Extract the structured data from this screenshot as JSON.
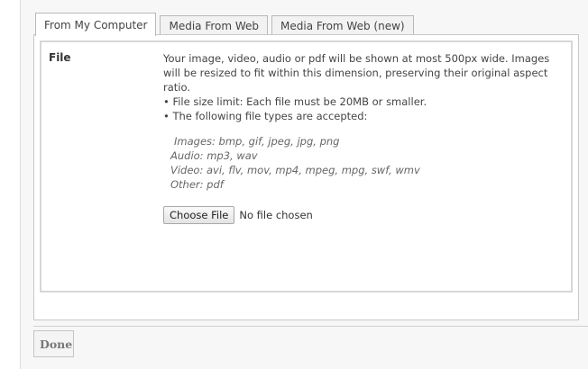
{
  "tabs": [
    {
      "label": "From My Computer"
    },
    {
      "label": "Media From Web"
    },
    {
      "label": "Media From Web (new)"
    }
  ],
  "file_field": {
    "label": "File",
    "description": "Your image, video, audio or pdf will be shown at most 500px wide. Images will be resized to fit within this dimension, preserving their original aspect ratio.",
    "bullets": [
      "• File size limit: Each file must be 20MB or smaller.",
      "• The following file types are accepted:"
    ],
    "accepted_types": [
      "Images: bmp, gif, jpeg, jpg, png",
      "Audio: mp3, wav",
      "Video: avi, flv, mov, mp4, mpeg, mpg, swf, wmv",
      "Other: pdf"
    ],
    "choose_button": "Choose File",
    "file_status": "No file chosen"
  },
  "footer": {
    "done_label": "Done"
  }
}
